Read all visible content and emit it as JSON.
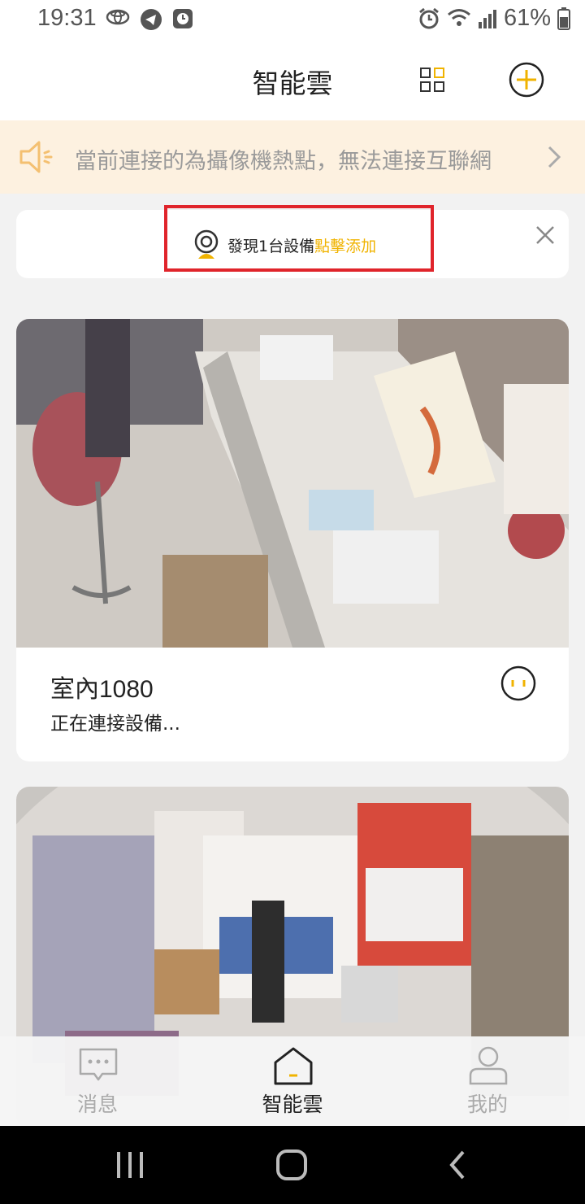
{
  "status_bar": {
    "time": "19:31",
    "battery": "61%"
  },
  "header": {
    "title": "智能雲"
  },
  "notice": {
    "text": "當前連接的為攝像機熱點，無法連接互聯網"
  },
  "discover": {
    "message": "發現1台設備",
    "action": "點擊添加"
  },
  "devices": [
    {
      "name": "室內1080",
      "status": "正在連接設備..."
    },
    {
      "name": "",
      "status": ""
    }
  ],
  "tabs": [
    {
      "label": "消息",
      "icon": "message-icon",
      "active": false
    },
    {
      "label": "智能雲",
      "icon": "home-icon",
      "active": true
    },
    {
      "label": "我的",
      "icon": "user-icon",
      "active": false
    }
  ],
  "colors": {
    "accent": "#f0b300",
    "highlight_border": "#e0242b",
    "notice_bg": "#fdf1e0"
  }
}
